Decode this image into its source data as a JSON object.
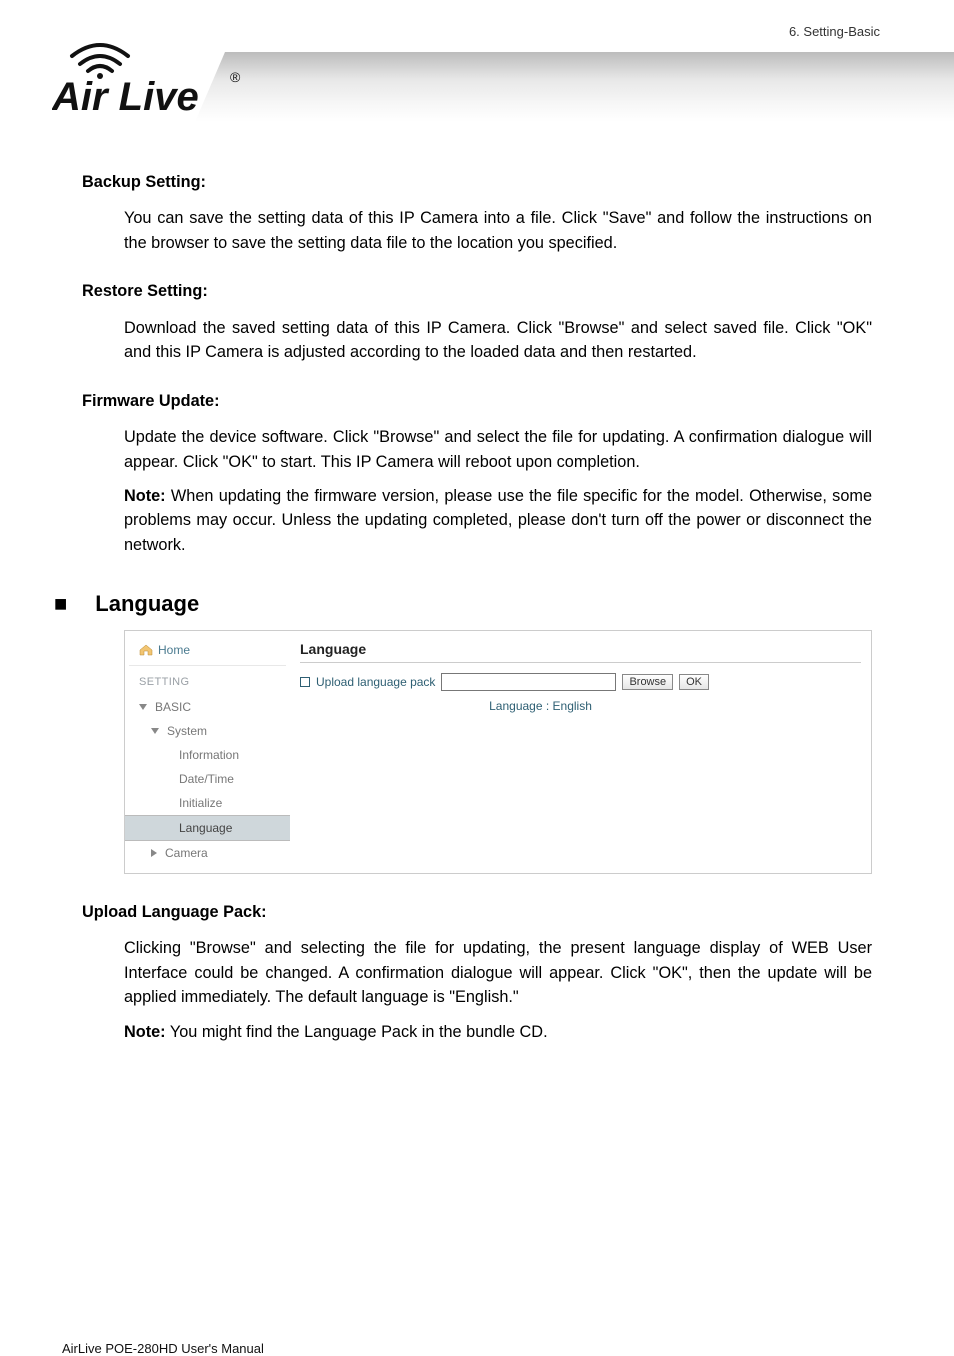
{
  "chapter": "6.  Setting-Basic",
  "logo_text": "Air Live",
  "logo_reg": "®",
  "sections": {
    "backup": {
      "title": "Backup Setting:",
      "body": "You can save the setting data of this IP Camera into a file. Click \"Save\" and follow the instructions on the browser to save the setting data file to the location you specified."
    },
    "restore": {
      "title": "Restore Setting:",
      "body": "Download the saved setting data of this IP Camera. Click \"Browse\" and select saved file. Click \"OK\" and this IP Camera is adjusted according to the loaded data and then restarted."
    },
    "firmware": {
      "title": "Firmware Update:",
      "body": "Update the device software. Click \"Browse\" and select the file for updating. A confirmation dialogue will appear. Click \"OK\" to start. This IP Camera will reboot upon completion.",
      "note_label": "Note:",
      "note_body": " When updating the firmware version, please use the file specific for the model.  Otherwise, some problems may occur. Unless the updating completed, please don't turn off the power or disconnect the network."
    },
    "language_section": {
      "bullet": "■",
      "title": "Language"
    },
    "upload_pack": {
      "title": "Upload Language Pack:",
      "body": "Clicking \"Browse\" and selecting the file for updating, the present language display of WEB User Interface could be changed. A confirmation dialogue will appear. Click \"OK\", then the update will be applied immediately. The default language is \"English.\"",
      "note_label": "Note:",
      "note_body": " You might find the Language Pack in the bundle CD."
    }
  },
  "screenshot": {
    "home": "Home",
    "setting": "SETTING",
    "tree": {
      "basic": "BASIC",
      "system": "System",
      "information": "Information",
      "datetime": "Date/Time",
      "initialize": "Initialize",
      "language": "Language",
      "camera": "Camera"
    },
    "panel": {
      "header": "Language",
      "upload_label": "Upload language pack",
      "browse": "Browse",
      "ok": "OK",
      "lang_line": "Language : English"
    }
  },
  "footer": "AirLive POE-280HD User's Manual"
}
